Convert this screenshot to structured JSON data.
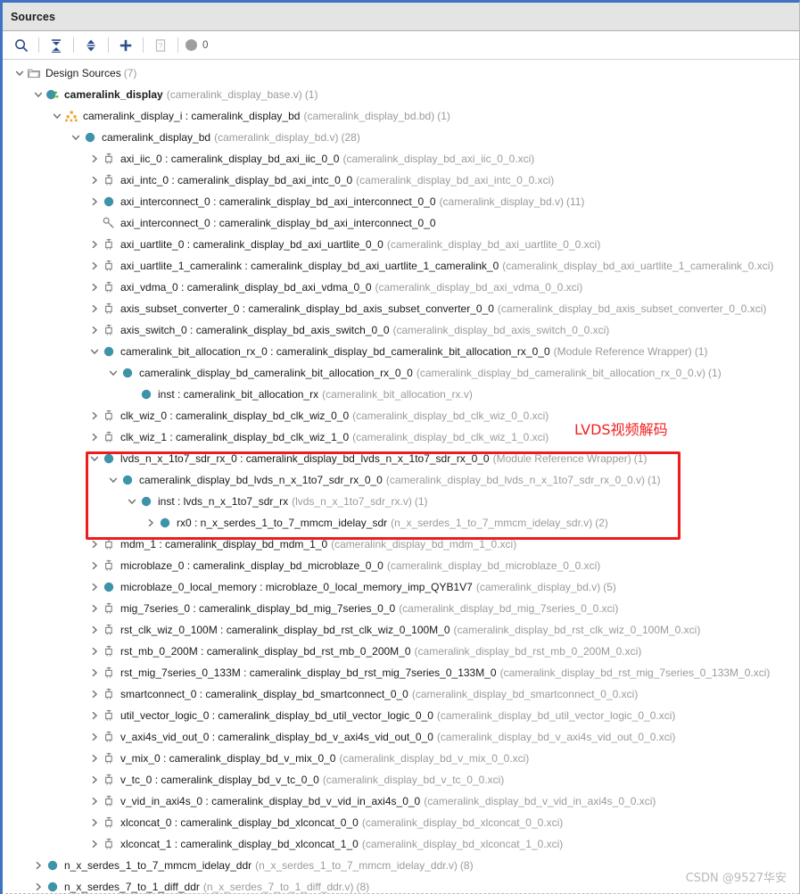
{
  "window": {
    "title": "Sources",
    "accent_color": "#3f73c4",
    "annotation_color": "#f22020"
  },
  "toolbar": {
    "buttons": [
      {
        "name": "search-icon",
        "label": "Search"
      },
      {
        "name": "collapse-all-icon",
        "label": "Collapse All"
      },
      {
        "name": "expand-all-icon",
        "label": "Expand All"
      },
      {
        "name": "add-sources-icon",
        "label": "Add Sources"
      },
      {
        "name": "report-icon",
        "label": "Report"
      }
    ],
    "badge_count": "0"
  },
  "annotation": {
    "text": "LVDS视频解码"
  },
  "watermark": {
    "text": "CSDN @9527华安"
  },
  "tree": {
    "rows": [
      {
        "indent": 0,
        "arrow": "down",
        "icon": "folder-icon",
        "label": "Design Sources",
        "sub": "",
        "count": "(7)",
        "bold": false
      },
      {
        "indent": 1,
        "arrow": "down",
        "icon": "module-top-icon",
        "label": "cameralink_display",
        "sub": "(cameralink_display_base.v)",
        "count": "(1)",
        "bold": true
      },
      {
        "indent": 2,
        "arrow": "down",
        "icon": "block-design-icon",
        "label": "cameralink_display_i : cameralink_display_bd",
        "sub": "(cameralink_display_bd.bd)",
        "count": "(1)",
        "bold": false
      },
      {
        "indent": 3,
        "arrow": "down",
        "icon": "module-icon",
        "label": "cameralink_display_bd",
        "sub": "(cameralink_display_bd.v)",
        "count": "(28)",
        "bold": false
      },
      {
        "indent": 4,
        "arrow": "right",
        "icon": "ip-core-icon",
        "label": "axi_iic_0 : cameralink_display_bd_axi_iic_0_0",
        "sub": "(cameralink_display_bd_axi_iic_0_0.xci)",
        "count": "",
        "bold": false
      },
      {
        "indent": 4,
        "arrow": "right",
        "icon": "ip-core-icon",
        "label": "axi_intc_0 : cameralink_display_bd_axi_intc_0_0",
        "sub": "(cameralink_display_bd_axi_intc_0_0.xci)",
        "count": "",
        "bold": false
      },
      {
        "indent": 4,
        "arrow": "right",
        "icon": "module-icon",
        "label": "axi_interconnect_0 : cameralink_display_bd_axi_interconnect_0_0",
        "sub": "(cameralink_display_bd.v)",
        "count": "(11)",
        "bold": false
      },
      {
        "indent": 4,
        "arrow": "none",
        "icon": "key-icon",
        "label": "axi_interconnect_0 : cameralink_display_bd_axi_interconnect_0_0",
        "sub": "",
        "count": "",
        "bold": false
      },
      {
        "indent": 4,
        "arrow": "right",
        "icon": "ip-core-icon",
        "label": "axi_uartlite_0 : cameralink_display_bd_axi_uartlite_0_0",
        "sub": "(cameralink_display_bd_axi_uartlite_0_0.xci)",
        "count": "",
        "bold": false
      },
      {
        "indent": 4,
        "arrow": "right",
        "icon": "ip-core-icon",
        "label": "axi_uartlite_1_cameralink : cameralink_display_bd_axi_uartlite_1_cameralink_0",
        "sub": "(cameralink_display_bd_axi_uartlite_1_cameralink_0.xci)",
        "count": "",
        "bold": false
      },
      {
        "indent": 4,
        "arrow": "right",
        "icon": "ip-core-icon",
        "label": "axi_vdma_0 : cameralink_display_bd_axi_vdma_0_0",
        "sub": "(cameralink_display_bd_axi_vdma_0_0.xci)",
        "count": "",
        "bold": false
      },
      {
        "indent": 4,
        "arrow": "right",
        "icon": "ip-core-icon",
        "label": "axis_subset_converter_0 : cameralink_display_bd_axis_subset_converter_0_0",
        "sub": "(cameralink_display_bd_axis_subset_converter_0_0.xci)",
        "count": "",
        "bold": false
      },
      {
        "indent": 4,
        "arrow": "right",
        "icon": "ip-core-icon",
        "label": "axis_switch_0 : cameralink_display_bd_axis_switch_0_0",
        "sub": "(cameralink_display_bd_axis_switch_0_0.xci)",
        "count": "",
        "bold": false
      },
      {
        "indent": 4,
        "arrow": "down",
        "icon": "module-icon",
        "label": "cameralink_bit_allocation_rx_0 : cameralink_display_bd_cameralink_bit_allocation_rx_0_0",
        "sub": "(Module Reference Wrapper)",
        "count": "(1)",
        "bold": false
      },
      {
        "indent": 5,
        "arrow": "down",
        "icon": "module-icon",
        "label": "cameralink_display_bd_cameralink_bit_allocation_rx_0_0",
        "sub": "(cameralink_display_bd_cameralink_bit_allocation_rx_0_0.v)",
        "count": "(1)",
        "bold": false
      },
      {
        "indent": 6,
        "arrow": "none",
        "icon": "module-icon",
        "label": "inst : cameralink_bit_allocation_rx",
        "sub": "(cameralink_bit_allocation_rx.v)",
        "count": "",
        "bold": false
      },
      {
        "indent": 4,
        "arrow": "right",
        "icon": "ip-core-icon",
        "label": "clk_wiz_0 : cameralink_display_bd_clk_wiz_0_0",
        "sub": "(cameralink_display_bd_clk_wiz_0_0.xci)",
        "count": "",
        "bold": false
      },
      {
        "indent": 4,
        "arrow": "right",
        "icon": "ip-core-icon",
        "label": "clk_wiz_1 : cameralink_display_bd_clk_wiz_1_0",
        "sub": "(cameralink_display_bd_clk_wiz_1_0.xci)",
        "count": "",
        "bold": false
      },
      {
        "indent": 4,
        "arrow": "down",
        "icon": "module-icon",
        "label": "lvds_n_x_1to7_sdr_rx_0 : cameralink_display_bd_lvds_n_x_1to7_sdr_rx_0_0",
        "sub": "(Module Reference Wrapper)",
        "count": "(1)",
        "bold": false
      },
      {
        "indent": 5,
        "arrow": "down",
        "icon": "module-icon",
        "label": "cameralink_display_bd_lvds_n_x_1to7_sdr_rx_0_0",
        "sub": "(cameralink_display_bd_lvds_n_x_1to7_sdr_rx_0_0.v)",
        "count": "(1)",
        "bold": false
      },
      {
        "indent": 6,
        "arrow": "down",
        "icon": "module-icon",
        "label": "inst : lvds_n_x_1to7_sdr_rx",
        "sub": "(lvds_n_x_1to7_sdr_rx.v)",
        "count": "(1)",
        "bold": false
      },
      {
        "indent": 7,
        "arrow": "right",
        "icon": "module-icon",
        "label": "rx0 : n_x_serdes_1_to_7_mmcm_idelay_sdr",
        "sub": "(n_x_serdes_1_to_7_mmcm_idelay_sdr.v)",
        "count": "(2)",
        "bold": false
      },
      {
        "indent": 4,
        "arrow": "right",
        "icon": "ip-core-icon",
        "label": "mdm_1 : cameralink_display_bd_mdm_1_0",
        "sub": "(cameralink_display_bd_mdm_1_0.xci)",
        "count": "",
        "bold": false
      },
      {
        "indent": 4,
        "arrow": "right",
        "icon": "ip-core-icon",
        "label": "microblaze_0 : cameralink_display_bd_microblaze_0_0",
        "sub": "(cameralink_display_bd_microblaze_0_0.xci)",
        "count": "",
        "bold": false
      },
      {
        "indent": 4,
        "arrow": "right",
        "icon": "module-icon",
        "label": "microblaze_0_local_memory : microblaze_0_local_memory_imp_QYB1V7",
        "sub": "(cameralink_display_bd.v)",
        "count": "(5)",
        "bold": false
      },
      {
        "indent": 4,
        "arrow": "right",
        "icon": "ip-core-icon",
        "label": "mig_7series_0 : cameralink_display_bd_mig_7series_0_0",
        "sub": "(cameralink_display_bd_mig_7series_0_0.xci)",
        "count": "",
        "bold": false
      },
      {
        "indent": 4,
        "arrow": "right",
        "icon": "ip-core-icon",
        "label": "rst_clk_wiz_0_100M : cameralink_display_bd_rst_clk_wiz_0_100M_0",
        "sub": "(cameralink_display_bd_rst_clk_wiz_0_100M_0.xci)",
        "count": "",
        "bold": false
      },
      {
        "indent": 4,
        "arrow": "right",
        "icon": "ip-core-icon",
        "label": "rst_mb_0_200M : cameralink_display_bd_rst_mb_0_200M_0",
        "sub": "(cameralink_display_bd_rst_mb_0_200M_0.xci)",
        "count": "",
        "bold": false
      },
      {
        "indent": 4,
        "arrow": "right",
        "icon": "ip-core-icon",
        "label": "rst_mig_7series_0_133M : cameralink_display_bd_rst_mig_7series_0_133M_0",
        "sub": "(cameralink_display_bd_rst_mig_7series_0_133M_0.xci)",
        "count": "",
        "bold": false
      },
      {
        "indent": 4,
        "arrow": "right",
        "icon": "ip-core-icon",
        "label": "smartconnect_0 : cameralink_display_bd_smartconnect_0_0",
        "sub": "(cameralink_display_bd_smartconnect_0_0.xci)",
        "count": "",
        "bold": false
      },
      {
        "indent": 4,
        "arrow": "right",
        "icon": "ip-core-icon",
        "label": "util_vector_logic_0 : cameralink_display_bd_util_vector_logic_0_0",
        "sub": "(cameralink_display_bd_util_vector_logic_0_0.xci)",
        "count": "",
        "bold": false
      },
      {
        "indent": 4,
        "arrow": "right",
        "icon": "ip-core-icon",
        "label": "v_axi4s_vid_out_0 : cameralink_display_bd_v_axi4s_vid_out_0_0",
        "sub": "(cameralink_display_bd_v_axi4s_vid_out_0_0.xci)",
        "count": "",
        "bold": false
      },
      {
        "indent": 4,
        "arrow": "right",
        "icon": "ip-core-icon",
        "label": "v_mix_0 : cameralink_display_bd_v_mix_0_0",
        "sub": "(cameralink_display_bd_v_mix_0_0.xci)",
        "count": "",
        "bold": false
      },
      {
        "indent": 4,
        "arrow": "right",
        "icon": "ip-core-icon",
        "label": "v_tc_0 : cameralink_display_bd_v_tc_0_0",
        "sub": "(cameralink_display_bd_v_tc_0_0.xci)",
        "count": "",
        "bold": false
      },
      {
        "indent": 4,
        "arrow": "right",
        "icon": "ip-core-icon",
        "label": "v_vid_in_axi4s_0 : cameralink_display_bd_v_vid_in_axi4s_0_0",
        "sub": "(cameralink_display_bd_v_vid_in_axi4s_0_0.xci)",
        "count": "",
        "bold": false
      },
      {
        "indent": 4,
        "arrow": "right",
        "icon": "ip-core-icon",
        "label": "xlconcat_0 : cameralink_display_bd_xlconcat_0_0",
        "sub": "(cameralink_display_bd_xlconcat_0_0.xci)",
        "count": "",
        "bold": false
      },
      {
        "indent": 4,
        "arrow": "right",
        "icon": "ip-core-icon",
        "label": "xlconcat_1 : cameralink_display_bd_xlconcat_1_0",
        "sub": "(cameralink_display_bd_xlconcat_1_0.xci)",
        "count": "",
        "bold": false
      },
      {
        "indent": 1,
        "arrow": "right",
        "icon": "module-icon",
        "label": "n_x_serdes_1_to_7_mmcm_idelay_ddr",
        "sub": "(n_x_serdes_1_to_7_mmcm_idelay_ddr.v)",
        "count": "(8)",
        "bold": false
      },
      {
        "indent": 1,
        "arrow": "right",
        "icon": "module-icon",
        "label": "n_x_serdes_7_to_1_diff_ddr",
        "sub": "(n_x_serdes_7_to_1_diff_ddr.v)",
        "count": "(8)",
        "bold": false
      }
    ]
  }
}
